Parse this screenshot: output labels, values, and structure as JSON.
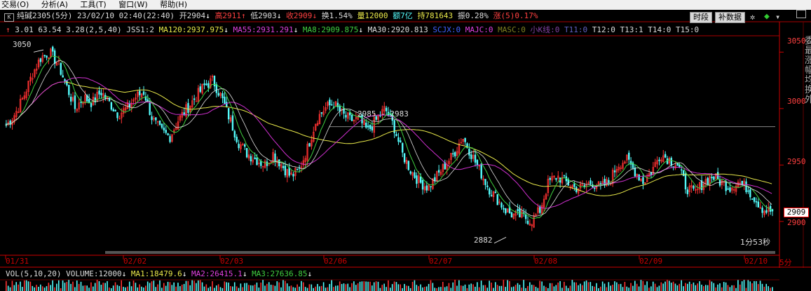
{
  "menu": [
    "交易(O)",
    "分析(A)",
    "工具(T)",
    "窗口(W)",
    "帮助(H)"
  ],
  "header": {
    "icon": "K",
    "symbol": "纯碱2305(5分)",
    "datetime": "23/02/10 02:40(22:40)",
    "open": "开2904",
    "high": "高2911",
    "low": "低2903",
    "close": "收2909",
    "turnover": "换1.54%",
    "volume": "量12000",
    "amount": "额7亿",
    "position": "持781643",
    "amplitude": "振0.28%",
    "change": "涨(5)0.17%",
    "btn_period": "时段",
    "btn_fill": "补数据"
  },
  "indicators": {
    "first": "3.01 63.54 3.28(2,5,40)",
    "jss": "JSS1:2",
    "ma120": "MA120:2937.975",
    "ma55": "MA55:2931.291",
    "ma8": "MA8:2909.875",
    "ma30": "MA30:2920.813",
    "scjx": "SCJX:0",
    "majc": "MAJC:0",
    "masc": "MASC:0",
    "xiaok": "小K线:0",
    "t11": "T11:0",
    "t12": "T12:0",
    "t13": "T13:1",
    "t14": "T14:0",
    "t15": "T15:0"
  },
  "price_axis": {
    "labels": [
      "3050",
      "3000",
      "2950",
      "2900"
    ],
    "current": "2909"
  },
  "annotations": {
    "high": "3050",
    "low": "2882",
    "range": "2985 - 2983",
    "timer": "1分53秒"
  },
  "dates": [
    "01/31",
    "02/02",
    "02/03",
    "02/06",
    "02/07",
    "02/08",
    "02/09",
    "02/10"
  ],
  "period": "5分",
  "volume_bar": {
    "label": "VOL(5,10,20)",
    "volume": "VOLUME:12000",
    "ma1": "MA1:18479.6",
    "ma2": "MA2:26415.1",
    "ma3": "MA3:27636.85"
  },
  "side_text": "委最涨幅均换外",
  "colors": {
    "up": "#ff3232",
    "down": "#54fcfc",
    "ma_yellow": "#e8e84a",
    "ma_magenta": "#d030d0",
    "ma_green": "#40d040",
    "ma_white": "#e0e0e0"
  },
  "chart_data": {
    "type": "candlestick",
    "y_range": [
      2880,
      3062
    ],
    "x_categories": [
      "01/31",
      "02/02",
      "02/03",
      "02/06",
      "02/07",
      "02/08",
      "02/09",
      "02/10"
    ],
    "close_path": [
      2985,
      2995,
      3010,
      3030,
      3045,
      3050,
      3040,
      3020,
      3000,
      3010,
      3005,
      3015,
      3005,
      2995,
      3000,
      3010,
      3015,
      2990,
      2980,
      2975,
      2990,
      3000,
      3010,
      3020,
      3025,
      3010,
      2990,
      2970,
      2960,
      2955,
      2950,
      2960,
      2950,
      2940,
      2945,
      2965,
      2990,
      3000,
      3005,
      2995,
      2990,
      2990,
      2980,
      2990,
      3000,
      2985,
      2960,
      2945,
      2935,
      2930,
      2940,
      2950,
      2960,
      2975,
      2960,
      2945,
      2930,
      2920,
      2910,
      2905,
      2905,
      2900,
      2910,
      2935,
      2940,
      2935,
      2930,
      2930,
      2935,
      2930,
      2935,
      2950,
      2955,
      2945,
      2935,
      2945,
      2960,
      2955,
      2950,
      2930,
      2925,
      2935,
      2940,
      2935,
      2930,
      2935,
      2930,
      2920,
      2910,
      2909
    ]
  }
}
